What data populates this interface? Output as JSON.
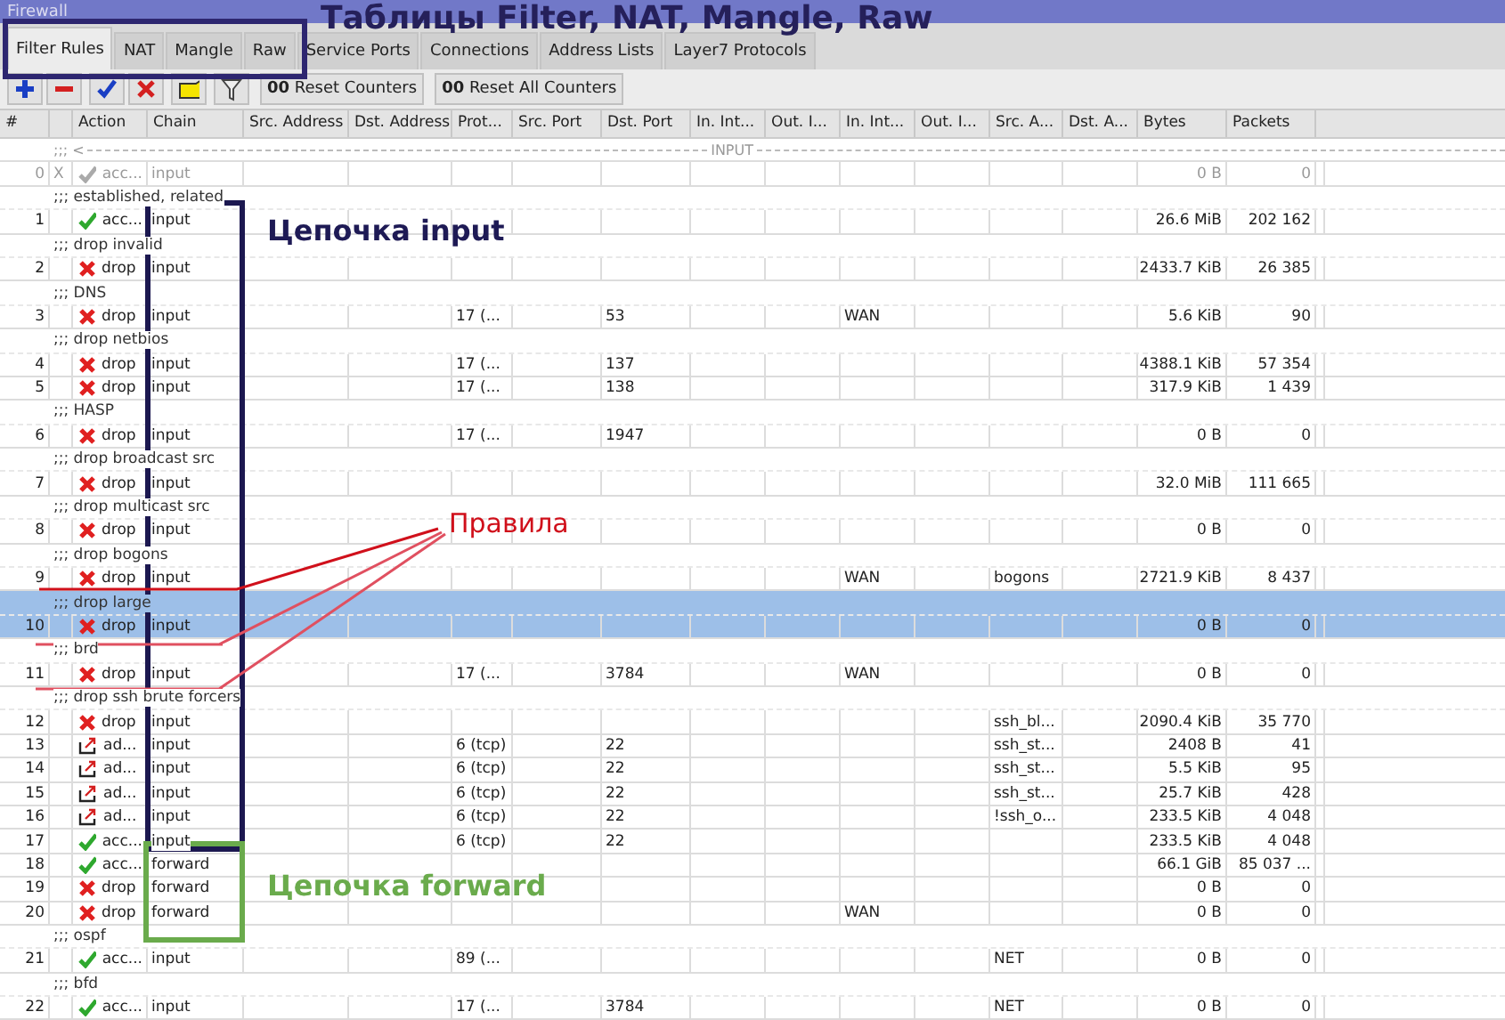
{
  "window": {
    "title": "Firewall"
  },
  "tabs": [
    {
      "label": "Filter Rules",
      "selected": true
    },
    {
      "label": "NAT",
      "selected": false
    },
    {
      "label": "Mangle",
      "selected": false
    },
    {
      "label": "Raw",
      "selected": false
    },
    {
      "label": "Service Ports",
      "selected": false
    },
    {
      "label": "Connections",
      "selected": false
    },
    {
      "label": "Address Lists",
      "selected": false
    },
    {
      "label": "Layer7 Protocols",
      "selected": false
    }
  ],
  "toolbar": [
    {
      "kind": "add"
    },
    {
      "kind": "remove"
    },
    {
      "kind": "enable"
    },
    {
      "kind": "disable"
    },
    {
      "kind": "comment"
    },
    {
      "kind": "filter"
    },
    {
      "kind": "text",
      "label": "**00** Reset Counters"
    },
    {
      "kind": "text",
      "label": "**00** Reset All Counters"
    }
  ],
  "columns": [
    "#",
    "Action",
    "Chain",
    "Src. Address",
    "Dst. Address",
    "Prot...",
    "Src. Port",
    "Dst. Port",
    "In. Int...",
    "Out. I...",
    "In. Int...",
    "Out. I...",
    "Src. A...",
    "Dst. A...",
    "Bytes",
    "Packets"
  ],
  "rows": [
    {
      "kind": "separator",
      "prefix": ";;; <",
      "label": "INPUT",
      "selected": false
    },
    {
      "kind": "rule",
      "number": "0",
      "disabled": true,
      "flag": "X",
      "action": {
        "kind": "accept",
        "label": "acc..."
      },
      "chain": "input",
      "bytes": "0 B",
      "packets": "0",
      "selected": false
    },
    {
      "kind": "comment",
      "text": ";;; established, related",
      "selected": false
    },
    {
      "kind": "rule",
      "number": "1",
      "disabled": false,
      "action": {
        "kind": "accept",
        "label": "acc..."
      },
      "chain": "input",
      "bytes": "26.6 MiB",
      "packets": "202 162",
      "selected": false
    },
    {
      "kind": "comment",
      "text": ";;; drop invalid",
      "selected": false
    },
    {
      "kind": "rule",
      "number": "2",
      "disabled": false,
      "action": {
        "kind": "drop",
        "label": "drop"
      },
      "chain": "input",
      "bytes": "2433.7 KiB",
      "packets": "26 385",
      "selected": false
    },
    {
      "kind": "comment",
      "text": ";;; DNS",
      "selected": false
    },
    {
      "kind": "rule",
      "number": "3",
      "disabled": false,
      "action": {
        "kind": "drop",
        "label": "drop"
      },
      "chain": "input",
      "protocol": "17 (...",
      "dst_port": "53",
      "in_interface_list": "WAN",
      "bytes": "5.6 KiB",
      "packets": "90",
      "selected": false
    },
    {
      "kind": "comment",
      "text": ";;; drop netbios",
      "selected": false
    },
    {
      "kind": "rule",
      "number": "4",
      "disabled": false,
      "action": {
        "kind": "drop",
        "label": "drop"
      },
      "chain": "input",
      "protocol": "17 (...",
      "dst_port": "137",
      "bytes": "4388.1 KiB",
      "packets": "57 354",
      "selected": false
    },
    {
      "kind": "rule",
      "number": "5",
      "disabled": false,
      "action": {
        "kind": "drop",
        "label": "drop"
      },
      "chain": "input",
      "protocol": "17 (...",
      "dst_port": "138",
      "bytes": "317.9 KiB",
      "packets": "1 439",
      "selected": false
    },
    {
      "kind": "comment",
      "text": ";;; HASP",
      "selected": false
    },
    {
      "kind": "rule",
      "number": "6",
      "disabled": false,
      "action": {
        "kind": "drop",
        "label": "drop"
      },
      "chain": "input",
      "protocol": "17 (...",
      "dst_port": "1947",
      "bytes": "0 B",
      "packets": "0",
      "selected": false
    },
    {
      "kind": "comment",
      "text": ";;; drop broadcast src",
      "selected": false
    },
    {
      "kind": "rule",
      "number": "7",
      "disabled": false,
      "action": {
        "kind": "drop",
        "label": "drop"
      },
      "chain": "input",
      "bytes": "32.0 MiB",
      "packets": "111 665",
      "selected": false
    },
    {
      "kind": "comment",
      "text": ";;; drop multicast src",
      "selected": false
    },
    {
      "kind": "rule",
      "number": "8",
      "disabled": false,
      "action": {
        "kind": "drop",
        "label": "drop"
      },
      "chain": "input",
      "bytes": "0 B",
      "packets": "0",
      "selected": false
    },
    {
      "kind": "comment",
      "text": ";;; drop bogons",
      "selected": false
    },
    {
      "kind": "rule",
      "number": "9",
      "disabled": false,
      "action": {
        "kind": "drop",
        "label": "drop"
      },
      "chain": "input",
      "in_interface_list": "WAN",
      "src_address_list": "bogons",
      "bytes": "2721.9 KiB",
      "packets": "8 437",
      "selected": false
    },
    {
      "kind": "comment",
      "text": ";;; drop large",
      "selected": true
    },
    {
      "kind": "rule",
      "number": "10",
      "disabled": false,
      "action": {
        "kind": "drop",
        "label": "drop"
      },
      "chain": "input",
      "bytes": "0 B",
      "packets": "0",
      "selected": true
    },
    {
      "kind": "comment",
      "text": ";;; brd",
      "selected": false
    },
    {
      "kind": "rule",
      "number": "11",
      "disabled": false,
      "action": {
        "kind": "drop",
        "label": "drop"
      },
      "chain": "input",
      "protocol": "17 (...",
      "dst_port": "3784",
      "in_interface_list": "WAN",
      "bytes": "0 B",
      "packets": "0",
      "selected": false
    },
    {
      "kind": "comment",
      "text": ";;; drop ssh brute forcers",
      "selected": false
    },
    {
      "kind": "rule",
      "number": "12",
      "disabled": false,
      "action": {
        "kind": "drop",
        "label": "drop"
      },
      "chain": "input",
      "src_address_list": "ssh_bl...",
      "bytes": "2090.4 KiB",
      "packets": "35 770",
      "selected": false
    },
    {
      "kind": "rule",
      "number": "13",
      "disabled": false,
      "action": {
        "kind": "add",
        "label": "ad..."
      },
      "chain": "input",
      "protocol": "6 (tcp)",
      "dst_port": "22",
      "src_address_list": "ssh_st...",
      "bytes": "2408 B",
      "packets": "41",
      "selected": false
    },
    {
      "kind": "rule",
      "number": "14",
      "disabled": false,
      "action": {
        "kind": "add",
        "label": "ad..."
      },
      "chain": "input",
      "protocol": "6 (tcp)",
      "dst_port": "22",
      "src_address_list": "ssh_st...",
      "bytes": "5.5 KiB",
      "packets": "95",
      "selected": false
    },
    {
      "kind": "rule",
      "number": "15",
      "disabled": false,
      "action": {
        "kind": "add",
        "label": "ad..."
      },
      "chain": "input",
      "protocol": "6 (tcp)",
      "dst_port": "22",
      "src_address_list": "ssh_st...",
      "bytes": "25.7 KiB",
      "packets": "428",
      "selected": false
    },
    {
      "kind": "rule",
      "number": "16",
      "disabled": false,
      "action": {
        "kind": "add",
        "label": "ad..."
      },
      "chain": "input",
      "protocol": "6 (tcp)",
      "dst_port": "22",
      "src_address_list": "!ssh_o...",
      "bytes": "233.5 KiB",
      "packets": "4 048",
      "selected": false
    },
    {
      "kind": "rule",
      "number": "17",
      "disabled": false,
      "action": {
        "kind": "accept",
        "label": "acc..."
      },
      "chain": "input",
      "protocol": "6 (tcp)",
      "dst_port": "22",
      "bytes": "233.5 KiB",
      "packets": "4 048",
      "selected": false
    },
    {
      "kind": "rule",
      "number": "18",
      "disabled": false,
      "action": {
        "kind": "accept",
        "label": "acc..."
      },
      "chain": "forward",
      "bytes": "66.1 GiB",
      "packets": "85 037 ...",
      "selected": false
    },
    {
      "kind": "rule",
      "number": "19",
      "disabled": false,
      "action": {
        "kind": "drop",
        "label": "drop"
      },
      "chain": "forward",
      "bytes": "0 B",
      "packets": "0",
      "selected": false
    },
    {
      "kind": "rule",
      "number": "20",
      "disabled": false,
      "action": {
        "kind": "drop",
        "label": "drop"
      },
      "chain": "forward",
      "in_interface_list": "WAN",
      "bytes": "0 B",
      "packets": "0",
      "selected": false
    },
    {
      "kind": "comment",
      "text": ";;; ospf",
      "selected": false
    },
    {
      "kind": "rule",
      "number": "21",
      "disabled": false,
      "action": {
        "kind": "accept",
        "label": "acc..."
      },
      "chain": "input",
      "protocol": "89 (...",
      "src_address_list": "NET",
      "bytes": "0 B",
      "packets": "0",
      "selected": false
    },
    {
      "kind": "comment",
      "text": ";;; bfd",
      "selected": false
    },
    {
      "kind": "rule",
      "number": "22",
      "disabled": false,
      "action": {
        "kind": "accept",
        "label": "acc..."
      },
      "chain": "input",
      "protocol": "17 (...",
      "dst_port": "3784",
      "src_address_list": "NET",
      "bytes": "0 B",
      "packets": "0",
      "selected": false
    }
  ],
  "annotations": [
    {
      "kind": "tables",
      "text": "Таблицы Filter, NAT, Mangle, Raw",
      "color": "#25205a"
    },
    {
      "kind": "input-chain",
      "text": "Цепочка input",
      "color": "#1e1a55"
    },
    {
      "kind": "rules",
      "text": "Правила",
      "color": "#d0101b"
    },
    {
      "kind": "forward-chain",
      "text": "Цепочка forward",
      "color": "#6aab4c"
    }
  ]
}
